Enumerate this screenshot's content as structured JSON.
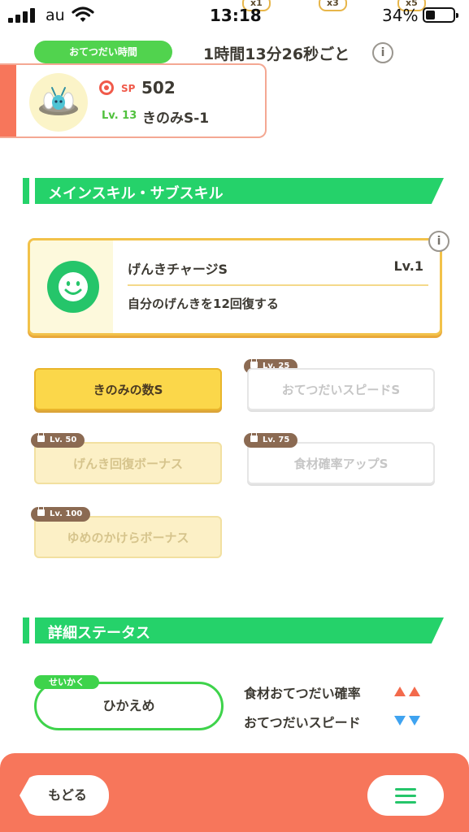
{
  "status_bar": {
    "carrier": "au",
    "time": "13:18",
    "battery": "34%",
    "multipliers": [
      "x1",
      "x3",
      "x5"
    ]
  },
  "help": {
    "label": "おてつだい時間",
    "interval": "1時間13分26秒ごと",
    "info": "i"
  },
  "pokemon": {
    "sp_label": "SP",
    "sp_value": "502",
    "level": "Lv. 13",
    "name": "きのみS-1"
  },
  "sections": {
    "skills": "メインスキル・サブスキル",
    "details": "詳細ステータス"
  },
  "main_skill": {
    "name": "げんきチャージS",
    "level": "Lv.1",
    "description": "自分のげんきを12回復する",
    "info": "i"
  },
  "sub_skills": [
    {
      "label": "きのみの数S",
      "lock": ""
    },
    {
      "label": "おてつだいスピードS",
      "lock": "Lv. 25"
    },
    {
      "label": "げんき回復ボーナス",
      "lock": "Lv. 50"
    },
    {
      "label": "食材確率アップS",
      "lock": "Lv. 75"
    },
    {
      "label": "ゆめのかけらボーナス",
      "lock": "Lv. 100"
    }
  ],
  "nature": {
    "tag": "せいかく",
    "value": "ひかえめ",
    "effects": [
      {
        "label": "食材おてつだい確率",
        "direction": "up",
        "color": "#f36a4c"
      },
      {
        "label": "おてつだいスピード",
        "direction": "down",
        "color": "#3fa3f0"
      }
    ]
  },
  "bottom_bar": {
    "back_label": "もどる",
    "menu_icon": "hamburger-menu-icon"
  },
  "colors": {
    "accent_green": "#25d26a",
    "coral": "#f7765b",
    "gold": "#f2c24a"
  }
}
